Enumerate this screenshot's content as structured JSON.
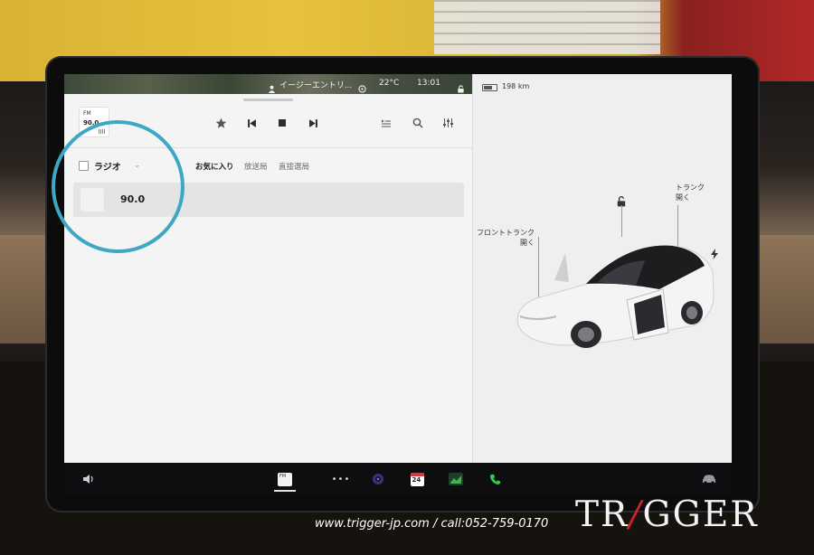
{
  "status_bar": {
    "profile_label": "イージーエントリ...",
    "temperature": "22°C",
    "time": "13:01",
    "range": "198 km"
  },
  "player": {
    "source_tile": {
      "band": "FM",
      "frequency": "90.0"
    },
    "controls": [
      "star-icon",
      "skip-previous-icon",
      "stop-icon",
      "skip-next-icon",
      "queue-icon",
      "search-icon",
      "equalizer-icon"
    ]
  },
  "browse": {
    "source_label": "ラジオ",
    "tabs": [
      {
        "label": "お気に入り",
        "active": true
      },
      {
        "label": "放送局",
        "active": false
      },
      {
        "label": "直接選局",
        "active": false
      }
    ],
    "stations": [
      {
        "frequency": "90.0"
      }
    ]
  },
  "vehicle": {
    "front_trunk": {
      "line1": "フロントトランク",
      "line2": "開く"
    },
    "trunk": {
      "line1": "トランク",
      "line2": "開く"
    }
  },
  "taskbar": {
    "calendar_day": "24",
    "media_tile": "FM"
  },
  "watermark": {
    "url": "www.trigger-jp.com / call:052-759-0170",
    "logo_left": "TR",
    "logo_right": "GGER"
  },
  "colors": {
    "highlight_circle": "#3ea7c3",
    "logo_accent": "#d1232a",
    "phone_green": "#2ecc53",
    "chart_green": "#3fb34f",
    "calendar_red": "#d53a3a"
  }
}
